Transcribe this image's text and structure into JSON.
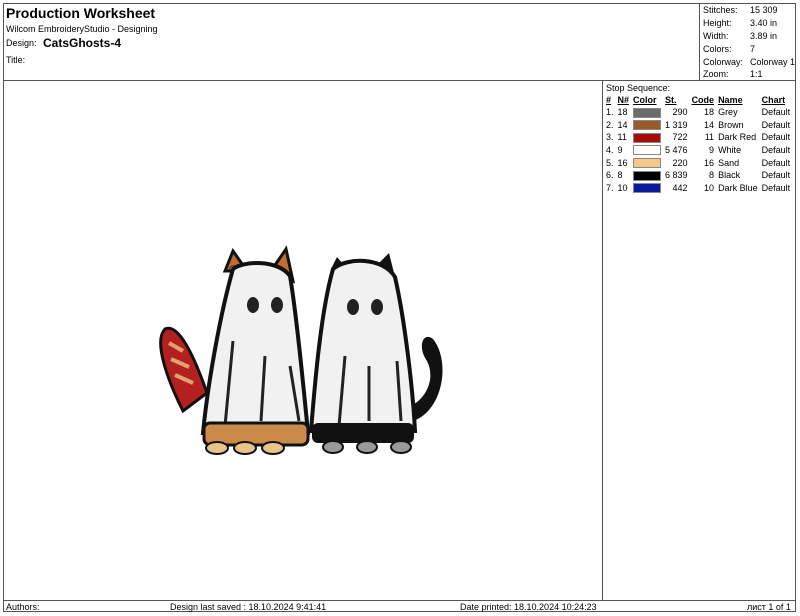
{
  "header": {
    "title": "Production Worksheet",
    "subtitle": "Wilcom EmbroideryStudio - Designing",
    "design_label": "Design:",
    "design_name": "CatsGhosts-4",
    "title_label": "Title:"
  },
  "info": [
    {
      "label": "Stitches:",
      "value": "15 309"
    },
    {
      "label": "Height:",
      "value": "3.40 in"
    },
    {
      "label": "Width:",
      "value": "3.89 in"
    },
    {
      "label": "Colors:",
      "value": "7"
    },
    {
      "label": "Colorway:",
      "value": "Colorway 1"
    },
    {
      "label": "Zoom:",
      "value": "1:1"
    }
  ],
  "stop_sequence": {
    "heading": "Stop Sequence:",
    "columns": [
      "#",
      "N#",
      "Color",
      "St.",
      "Code",
      "Name",
      "Chart"
    ],
    "rows": [
      {
        "idx": "1.",
        "n": "18",
        "color": "#6b6b6b",
        "st": "290",
        "code": "18",
        "name": "Grey",
        "chart": "Default"
      },
      {
        "idx": "2.",
        "n": "14",
        "color": "#9a5a2a",
        "st": "1 319",
        "code": "14",
        "name": "Brown",
        "chart": "Default"
      },
      {
        "idx": "3.",
        "n": "11",
        "color": "#a50d0d",
        "st": "722",
        "code": "11",
        "name": "Dark Red",
        "chart": "Default"
      },
      {
        "idx": "4.",
        "n": "9",
        "color": "#ffffff",
        "st": "5 476",
        "code": "9",
        "name": "White",
        "chart": "Default"
      },
      {
        "idx": "5.",
        "n": "16",
        "color": "#f5c98a",
        "st": "220",
        "code": "16",
        "name": "Sand",
        "chart": "Default"
      },
      {
        "idx": "6.",
        "n": "8",
        "color": "#000000",
        "st": "6 839",
        "code": "8",
        "name": "Black",
        "chart": "Default"
      },
      {
        "idx": "7.",
        "n": "10",
        "color": "#0a1a9c",
        "st": "442",
        "code": "10",
        "name": "Dark Blue",
        "chart": "Default"
      }
    ]
  },
  "footer": {
    "authors": "Authors:",
    "last_saved": "Design last saved : 18.10.2024 9:41:41",
    "printed": "Date printed: 18.10.2024 10:24:23",
    "sheet": "лист 1 of 1"
  }
}
